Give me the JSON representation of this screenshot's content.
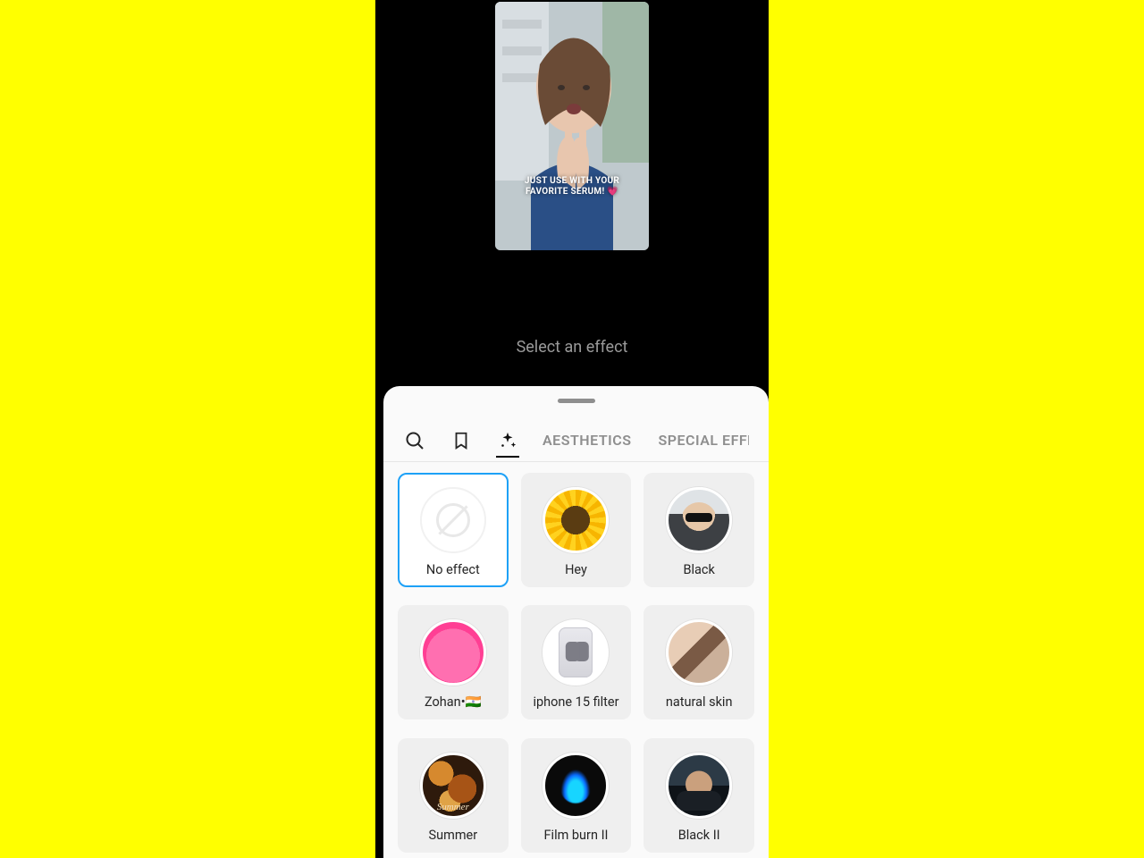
{
  "preview": {
    "caption_line1": "JUST USE WITH YOUR",
    "caption_line2": "FAVORITE SERUM! 💗"
  },
  "prompt_label": "Select an effect",
  "tabs": {
    "aesthetics": "AESTHETICS",
    "special_effects": "SPECIAL EFFECTS"
  },
  "effects": [
    {
      "label": "No effect",
      "thumb": "none",
      "selected": true
    },
    {
      "label": "Hey",
      "thumb": "sunflower",
      "selected": false
    },
    {
      "label": "Black",
      "thumb": "guy-shades",
      "selected": false
    },
    {
      "label": "Zohan•🇮🇳",
      "thumb": "pink-hood",
      "selected": false
    },
    {
      "label": "iphone 15 filter",
      "thumb": "iphone-back",
      "selected": false
    },
    {
      "label": "natural skin",
      "thumb": "natural-skin",
      "selected": false
    },
    {
      "label": "Summer",
      "thumb": "autumn",
      "selected": false
    },
    {
      "label": "Film burn II",
      "thumb": "blueflame",
      "selected": false
    },
    {
      "label": "Black II",
      "thumb": "gym-guy",
      "selected": false
    }
  ],
  "summer_overlay_text": "Summer"
}
